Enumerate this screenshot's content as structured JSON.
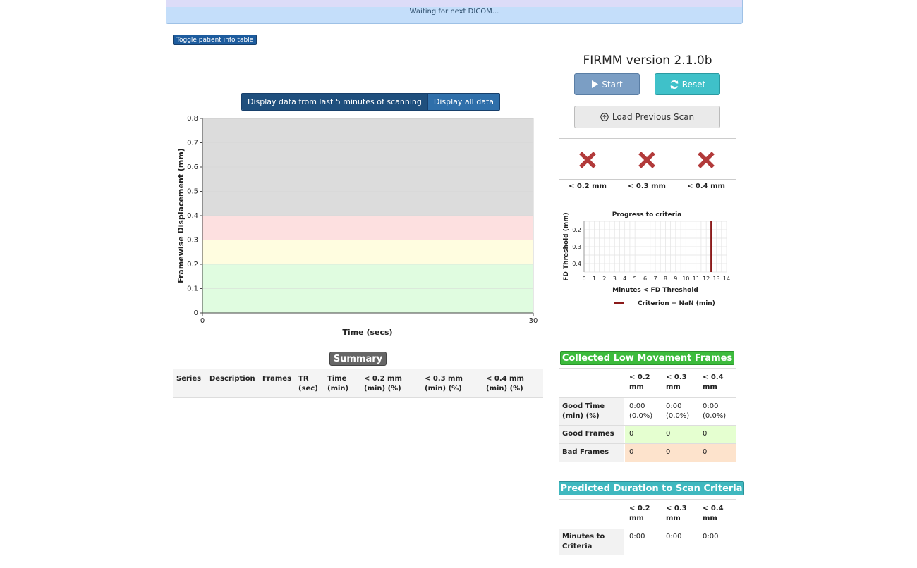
{
  "status": {
    "message": "Waiting for next DICOM..."
  },
  "toggle_patient_table_label": "Toggle patient info table",
  "view_toggle": {
    "last5_label": "Display data from last 5 minutes of scanning",
    "all_label": "Display all data"
  },
  "chart_data": [
    {
      "type": "area",
      "title": "",
      "xlabel": "Time (secs)",
      "ylabel": "Framewise Displacement (mm)",
      "xlim": [
        0,
        30
      ],
      "ylim": [
        0,
        0.8
      ],
      "x_ticks": [
        "0",
        "30"
      ],
      "y_ticks": [
        "0",
        "0.1",
        "0.2",
        "0.3",
        "0.4",
        "0.5",
        "0.6",
        "0.7",
        "0.8"
      ],
      "bands": [
        {
          "from": 0,
          "to": 0.2,
          "color": "#e0fce0"
        },
        {
          "from": 0.2,
          "to": 0.3,
          "color": "#fffde0"
        },
        {
          "from": 0.3,
          "to": 0.4,
          "color": "#fde0e0"
        },
        {
          "from": 0.4,
          "to": 0.8,
          "color": "#dcdcdc"
        }
      ],
      "series": []
    },
    {
      "type": "bar",
      "title": "Progress to criteria",
      "xlabel": "Minutes < FD Threshold",
      "ylabel": "FD Threshold (mm)",
      "xlim": [
        0,
        14
      ],
      "x_ticks": [
        "0",
        "1",
        "2",
        "3",
        "4",
        "5",
        "6",
        "7",
        "8",
        "9",
        "10",
        "11",
        "12",
        "13",
        "14"
      ],
      "categories": [
        "0.2",
        "0.3",
        "0.4"
      ],
      "values": [
        0,
        0,
        0
      ],
      "criterion_line_x": 12.5,
      "criterion_color": "#8b1a1a",
      "legend": "Criterion = NaN (min)"
    }
  ],
  "summary": {
    "badge": "Summary",
    "headers": [
      "Series",
      "Description",
      "Frames",
      "TR\n(sec)",
      "Time\n(min)",
      "< 0.2 mm\n(min) (%)",
      "< 0.3 mm\n(min) (%)",
      "< 0.4 mm\n(min) (%)"
    ]
  },
  "right": {
    "version": "FIRMM version 2.1.0b",
    "start_label": "Start",
    "reset_label": "Reset",
    "load_label": "Load Previous Scan",
    "thresholds": [
      "< 0.2 mm",
      "< 0.3 mm",
      "< 0.4 mm"
    ],
    "status_icon": "x-mark-icon",
    "status_color": "#b23a3a"
  },
  "collected": {
    "badge": "Collected Low Movement Frames",
    "headers": [
      "< 0.2\nmm",
      "< 0.3\nmm",
      "< 0.4\nmm"
    ],
    "rows": [
      {
        "label": "Good Time\n(min) (%)",
        "values": [
          "0:00\n(0.0%)",
          "0:00\n(0.0%)",
          "0:00\n(0.0%)"
        ]
      },
      {
        "label": "Good Frames",
        "values": [
          "0",
          "0",
          "0"
        ]
      },
      {
        "label": "Bad Frames",
        "values": [
          "0",
          "0",
          "0"
        ]
      }
    ]
  },
  "predicted": {
    "badge": "Predicted Duration to Scan Criteria",
    "headers": [
      "< 0.2\nmm",
      "< 0.3\nmm",
      "< 0.4\nmm"
    ],
    "rows": [
      {
        "label": "Minutes to\nCriteria",
        "values": [
          "0:00",
          "0:00",
          "0:00"
        ]
      }
    ]
  }
}
